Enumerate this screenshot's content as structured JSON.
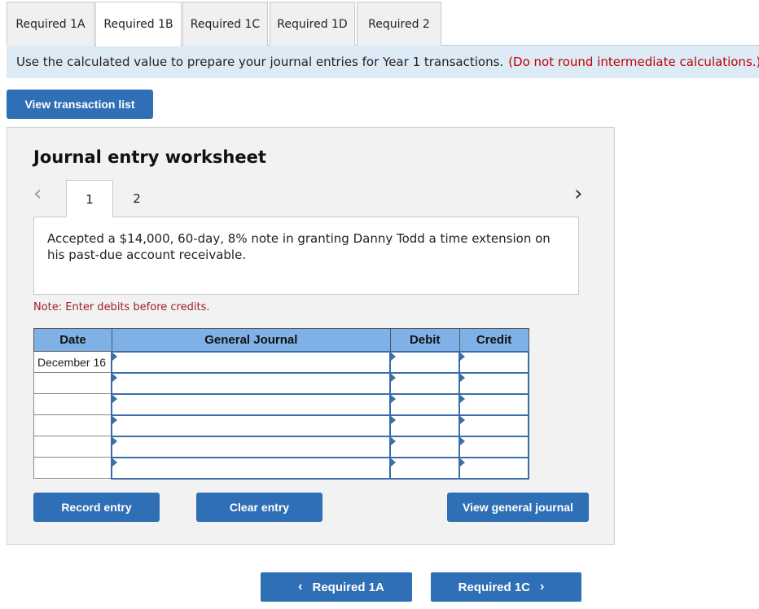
{
  "tabs": [
    {
      "label": "Required 1A",
      "active": false
    },
    {
      "label": "Required 1B",
      "active": true
    },
    {
      "label": "Required 1C",
      "active": false
    },
    {
      "label": "Required 1D",
      "active": false
    },
    {
      "label": "Required 2",
      "active": false
    }
  ],
  "banner": {
    "text": "Use the calculated value to prepare your journal entries for Year 1 transactions.",
    "note": "(Do not round intermediate calculations.)"
  },
  "view_transaction_list": "View transaction list",
  "worksheet": {
    "title": "Journal entry worksheet",
    "pages": [
      "1",
      "2"
    ],
    "description": "Accepted a $14,000, 60-day, 8% note in granting Danny Todd a time extension on his past-due account receivable.",
    "note": "Note: Enter debits before credits.",
    "columns": [
      "Date",
      "General Journal",
      "Debit",
      "Credit"
    ],
    "rows": [
      {
        "date": "December 16"
      },
      {
        "date": ""
      },
      {
        "date": ""
      },
      {
        "date": ""
      },
      {
        "date": ""
      },
      {
        "date": ""
      }
    ],
    "buttons": {
      "record": "Record entry",
      "clear": "Clear entry",
      "view_gj": "View general journal"
    }
  },
  "nav": {
    "prev": "Required 1A",
    "next": "Required 1C"
  },
  "icons": {
    "prev": "chevron-left-icon",
    "next": "chevron-right-icon"
  },
  "colors": {
    "accent": "#2f6fb6",
    "header": "#7fb0e6",
    "banner": "#ddebf7",
    "warning": "#c00000"
  }
}
